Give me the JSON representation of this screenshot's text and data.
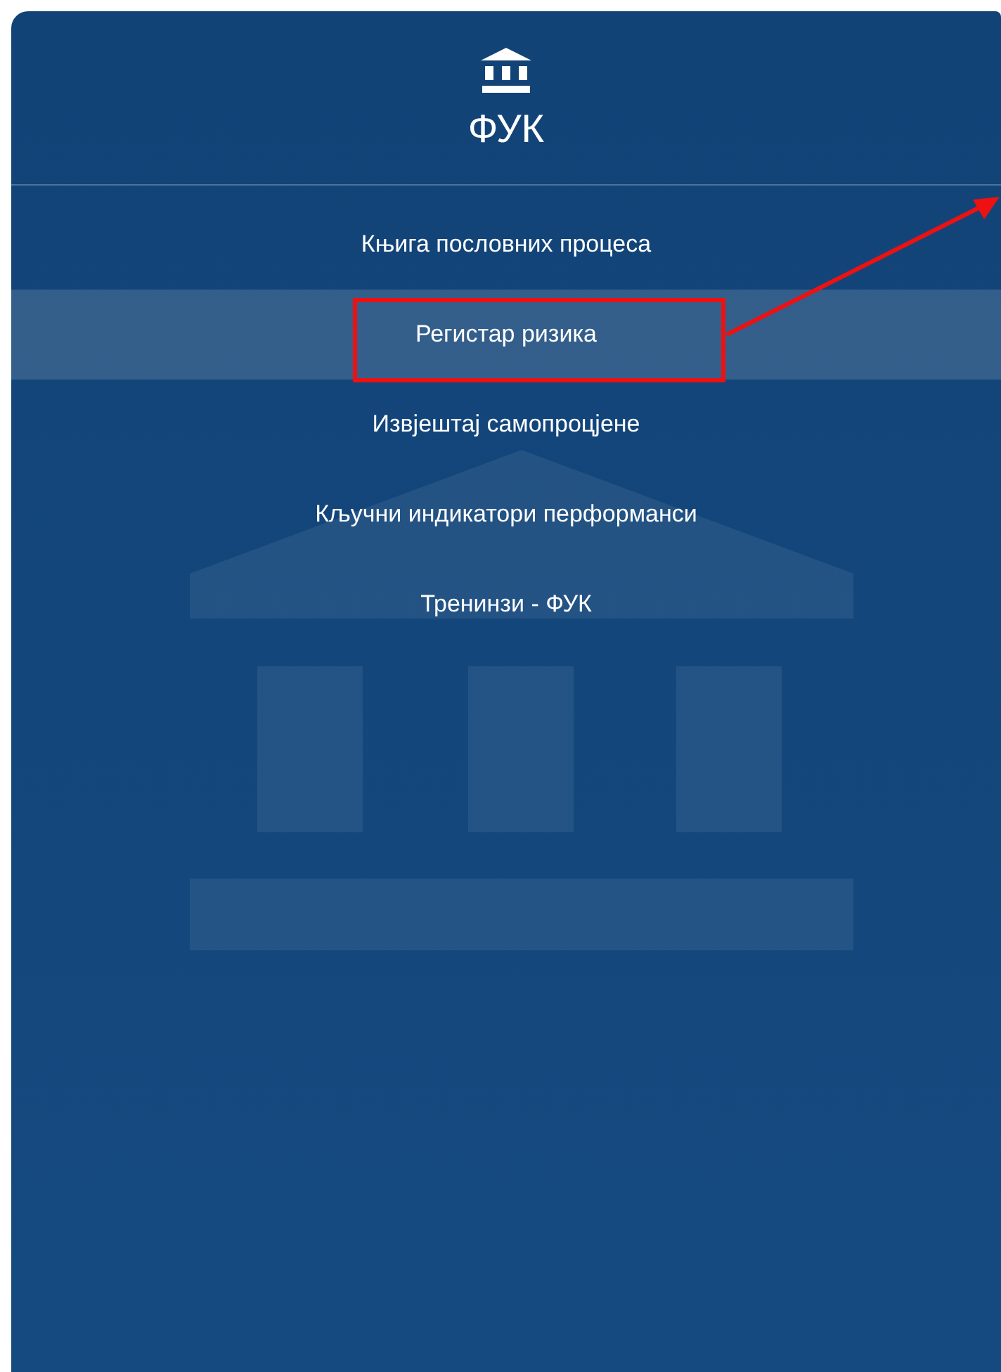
{
  "sidebar": {
    "title": "ФУК",
    "items": [
      {
        "label": "Књига пословних процеса",
        "selected": false,
        "annotated": false
      },
      {
        "label": "Регистар ризика",
        "selected": true,
        "annotated": true
      },
      {
        "label": "Извјештај самопроцјене",
        "selected": false,
        "annotated": false
      },
      {
        "label": "Кључни индикатори перформанси",
        "selected": false,
        "annotated": false
      },
      {
        "label": "Тренинзи - ФУК",
        "selected": false,
        "annotated": false
      }
    ]
  }
}
